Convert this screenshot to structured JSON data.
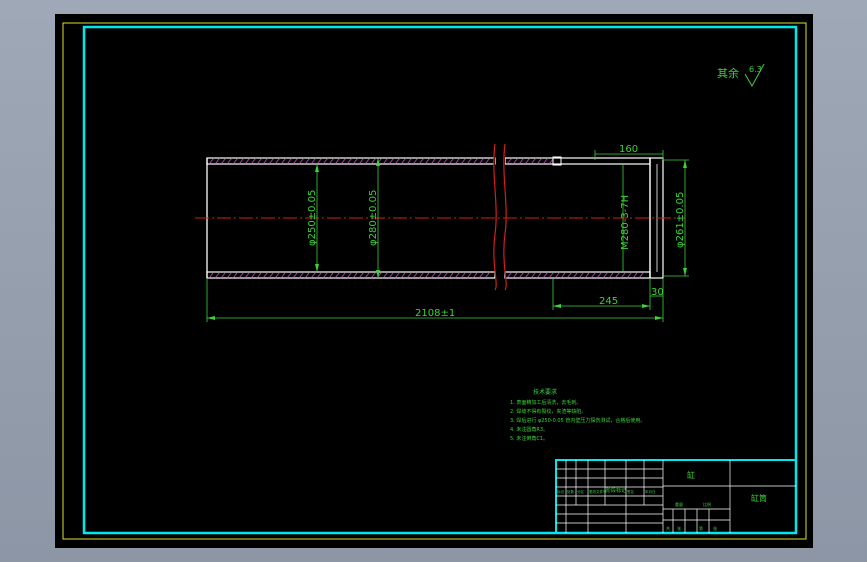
{
  "drawing": {
    "roughness_note": "其余",
    "roughness_value": "6.3",
    "dimensions": {
      "inner_diameter": "φ250±0.05",
      "outer_diameter": "φ280±0.05",
      "thread_spec": "M280-3-7H",
      "relief_diameter": "φ261±0.05",
      "total_length": "2108±1",
      "thread_length": "245",
      "relief_length": "30",
      "end_length": "160"
    },
    "tech_requirements": {
      "title": "技术要求",
      "items": [
        "1. 表面精加工后清洗，去毛刺。",
        "2. 焊缝不得有裂纹，夹渣等缺陷。",
        "3. 焊后进行 φ250-0.05 管内壁压力探伤测试，合格后使用。",
        "4. 未注圆角R3。",
        "5. 未注倒角C1。"
      ]
    },
    "title_block": {
      "part_name": "缸",
      "drawing_label": "缸筒",
      "cell_marks": [
        "标记",
        "处数",
        "分区",
        "更改文件号",
        "签名",
        "年月日"
      ],
      "scale_label": "阶段标记",
      "sheet_labels": [
        "重量",
        "比例"
      ],
      "bottom_labels": [
        "共",
        "张",
        "第",
        "张"
      ]
    }
  },
  "colors": {
    "frame": "#00e8ee",
    "outer_border": "#e0e030",
    "geometry": "#ffffff",
    "hatch": "#d050d0",
    "centerline": "#d02020",
    "dimension": "#3cd23c"
  }
}
